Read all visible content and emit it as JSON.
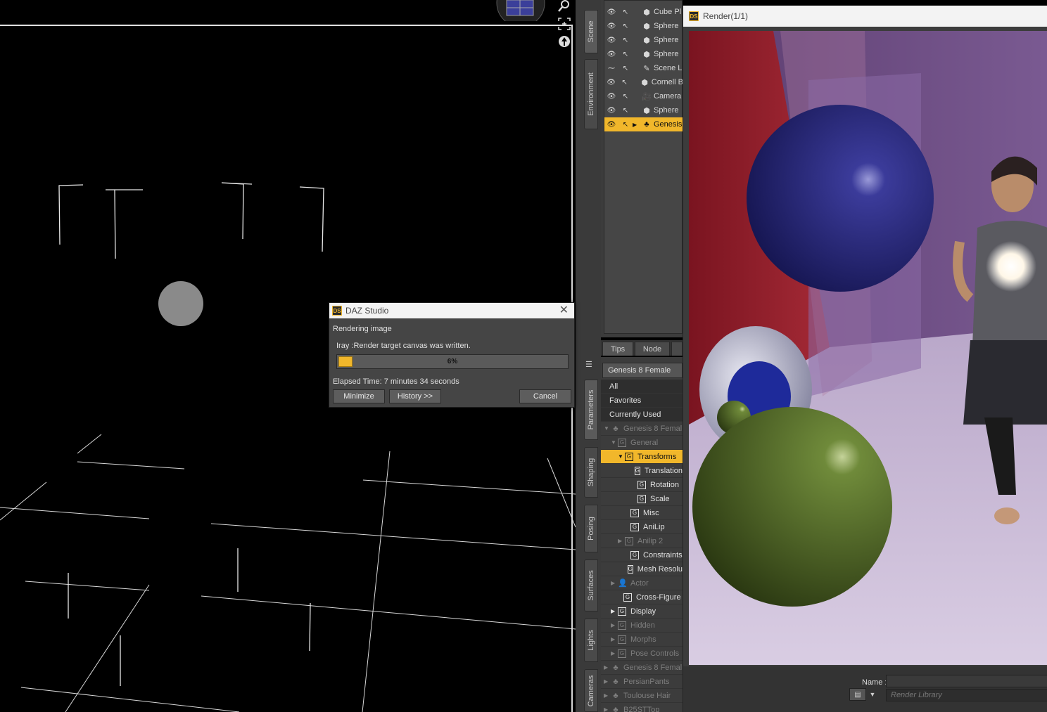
{
  "viewport": {
    "icons": [
      "perspective-cube-icon",
      "zoom-icon",
      "frame-icon",
      "orbit-icon"
    ]
  },
  "side_tabs": {
    "scene": "Scene",
    "environment": "Environment",
    "parameters": "Parameters",
    "shaping": "Shaping",
    "posing": "Posing",
    "surfaces": "Surfaces",
    "lights": "Lights",
    "cameras": "Cameras"
  },
  "scene": {
    "items": [
      {
        "label": "Cube Pl",
        "icon": "cube"
      },
      {
        "label": "Sphere",
        "icon": "cube"
      },
      {
        "label": "Sphere",
        "icon": "cube"
      },
      {
        "label": "Sphere",
        "icon": "cube"
      },
      {
        "label": "Scene L",
        "icon": "light"
      },
      {
        "label": "Cornell B",
        "icon": "cube"
      },
      {
        "label": "Camera",
        "icon": "camera"
      },
      {
        "label": "Sphere",
        "icon": "cube"
      },
      {
        "label": "Genesis",
        "icon": "figure",
        "selected": true
      }
    ]
  },
  "bottom_tabs": {
    "tips": "Tips",
    "node": "Node"
  },
  "parameters": {
    "selected_node": "Genesis 8 Female",
    "filters": [
      "All",
      "Favorites",
      "Currently Used"
    ],
    "tree": [
      {
        "label": "Genesis 8 Femal",
        "arrow": "▼",
        "icon": "figure",
        "dim": true
      },
      {
        "label": "General",
        "arrow": "▼",
        "icon": "group",
        "dim": true
      },
      {
        "label": "Transforms",
        "arrow": "▼",
        "icon": "group",
        "selected": true
      },
      {
        "label": "Translation",
        "arrow": "",
        "icon": "group"
      },
      {
        "label": "Rotation",
        "arrow": "",
        "icon": "group"
      },
      {
        "label": "Scale",
        "arrow": "",
        "icon": "group"
      },
      {
        "label": "Misc",
        "arrow": "",
        "icon": "group"
      },
      {
        "label": "AniLip",
        "arrow": "",
        "icon": "group"
      },
      {
        "label": "Anilip 2",
        "arrow": "▶",
        "icon": "group",
        "dim": true
      },
      {
        "label": "Constraints",
        "arrow": "",
        "icon": "group"
      },
      {
        "label": "Mesh Resolu",
        "arrow": "",
        "icon": "group"
      },
      {
        "label": "Actor",
        "arrow": "▶",
        "icon": "actor",
        "dim": true
      },
      {
        "label": "Cross-Figure",
        "arrow": "",
        "icon": "group"
      },
      {
        "label": "Display",
        "arrow": "▶",
        "icon": "group"
      },
      {
        "label": "Hidden",
        "arrow": "▶",
        "icon": "group",
        "dim": true
      },
      {
        "label": "Morphs",
        "arrow": "▶",
        "icon": "group",
        "dim": true
      },
      {
        "label": "Pose Controls",
        "arrow": "▶",
        "icon": "group",
        "dim": true
      },
      {
        "label": "Genesis 8 Femal",
        "arrow": "▶",
        "icon": "figure",
        "dim": true
      },
      {
        "label": "PersianPants",
        "arrow": "▶",
        "icon": "figure",
        "dim": true
      },
      {
        "label": "Toulouse Hair",
        "arrow": "▶",
        "icon": "figure",
        "dim": true
      },
      {
        "label": "B25STTop",
        "arrow": "▶",
        "icon": "figure",
        "dim": true
      }
    ]
  },
  "render_window": {
    "logo": "DS",
    "title": "Render(1/1)",
    "name_label": "Name :",
    "library_placeholder": "Render Library"
  },
  "dialog": {
    "logo": "DS",
    "title": "DAZ Studio",
    "status": "Rendering image",
    "message": "Iray :Render target canvas was written.",
    "progress": 0.06,
    "progress_label": "6%",
    "elapsed": "Elapsed Time:  7 minutes 34 seconds",
    "minimize": "Minimize",
    "history": "History >>",
    "cancel": "Cancel"
  },
  "colors": {
    "accent": "#f1b72b",
    "panel": "#3c3c3c",
    "viewport": "#000000"
  }
}
